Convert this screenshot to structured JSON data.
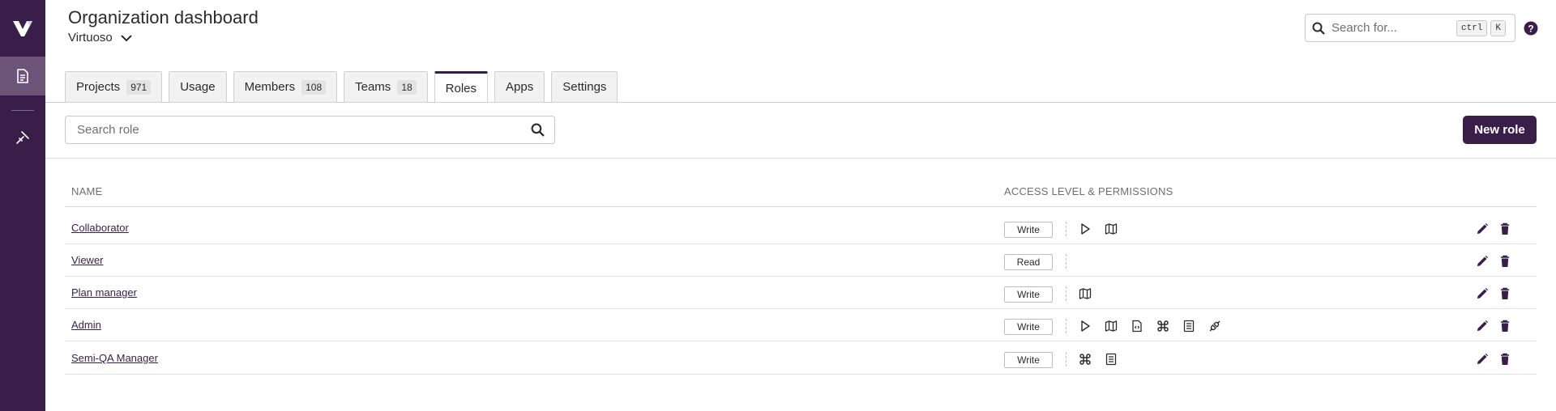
{
  "header": {
    "title": "Organization dashboard",
    "org_name": "Virtuoso"
  },
  "global_search": {
    "placeholder": "Search for...",
    "shortcut_1": "ctrl",
    "shortcut_2": "K"
  },
  "tabs": [
    {
      "label": "Projects",
      "count": "971"
    },
    {
      "label": "Usage",
      "count": ""
    },
    {
      "label": "Members",
      "count": "108"
    },
    {
      "label": "Teams",
      "count": "18"
    },
    {
      "label": "Roles",
      "count": "",
      "active": true
    },
    {
      "label": "Apps",
      "count": ""
    },
    {
      "label": "Settings",
      "count": ""
    }
  ],
  "role_search": {
    "placeholder": "Search role"
  },
  "new_role_label": "New role",
  "table": {
    "col_name": "NAME",
    "col_access": "ACCESS LEVEL & PERMISSIONS",
    "rows": [
      {
        "name": "Collaborator",
        "access": "Write",
        "permissions": [
          "play-icon",
          "map-icon"
        ]
      },
      {
        "name": "Viewer",
        "access": "Read",
        "permissions": []
      },
      {
        "name": "Plan manager",
        "access": "Write",
        "permissions": [
          "map-icon"
        ]
      },
      {
        "name": "Admin",
        "access": "Write",
        "permissions": [
          "play-icon",
          "map-icon",
          "code-file-icon",
          "command-icon",
          "list-icon",
          "plug-icon"
        ]
      },
      {
        "name": "Semi-QA Manager",
        "access": "Write",
        "permissions": [
          "command-icon",
          "list-icon"
        ]
      }
    ]
  },
  "colors": {
    "brand": "#3a1e4a",
    "sidebar_active": "#6b5478"
  }
}
